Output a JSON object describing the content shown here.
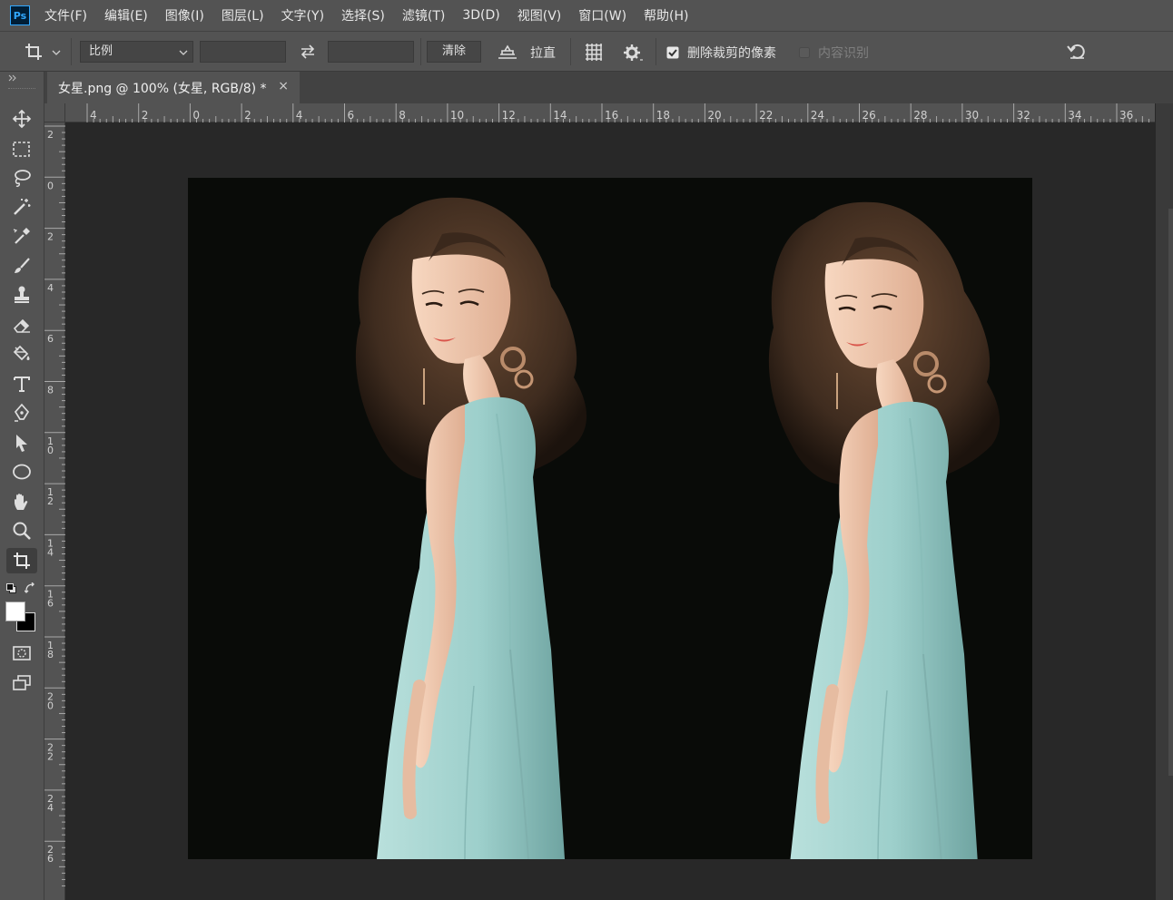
{
  "menubar": {
    "app_icon": "Ps",
    "items": [
      "文件(F)",
      "编辑(E)",
      "图像(I)",
      "图层(L)",
      "文字(Y)",
      "选择(S)",
      "滤镜(T)",
      "3D(D)",
      "视图(V)",
      "窗口(W)",
      "帮助(H)"
    ]
  },
  "options": {
    "ratio_select": "比例",
    "clear_button": "清除",
    "straighten_label": "拉直",
    "delete_pixels_label": "删除裁剪的像素",
    "delete_pixels_checked": true,
    "content_aware_label": "内容识别",
    "content_aware_checked": false
  },
  "document_tab": {
    "title": "女星.png @ 100% (女星, RGB/8) *",
    "close": "×"
  },
  "hruler_labels": [
    "4",
    "2",
    "0",
    "2",
    "4",
    "6",
    "8",
    "10",
    "12",
    "14",
    "16",
    "18",
    "20",
    "22",
    "24",
    "26",
    "28",
    "30",
    "32",
    "34",
    "36"
  ],
  "vruler_labels": [
    "2",
    "0",
    "2",
    "4",
    "6",
    "8",
    "10",
    "12",
    "14",
    "16",
    "18",
    "20",
    "22",
    "24",
    "26"
  ],
  "tools": [
    "move-icon",
    "marquee-icon",
    "lasso-icon",
    "magic-wand-icon",
    "eyedropper-icon",
    "brush-icon",
    "stamp-icon",
    "eraser-icon",
    "bucket-icon",
    "type-icon",
    "pen-icon",
    "path-select-icon",
    "ellipse-icon",
    "hand-icon",
    "zoom-icon",
    "crop-icon",
    "quick-mask-icon",
    "screen-mode-icon"
  ],
  "colors": {
    "foreground": "#ffffff",
    "background": "#000000",
    "dress": "#a3d3cf",
    "hair": "#4a3526",
    "skin": "#f0c9ad"
  }
}
